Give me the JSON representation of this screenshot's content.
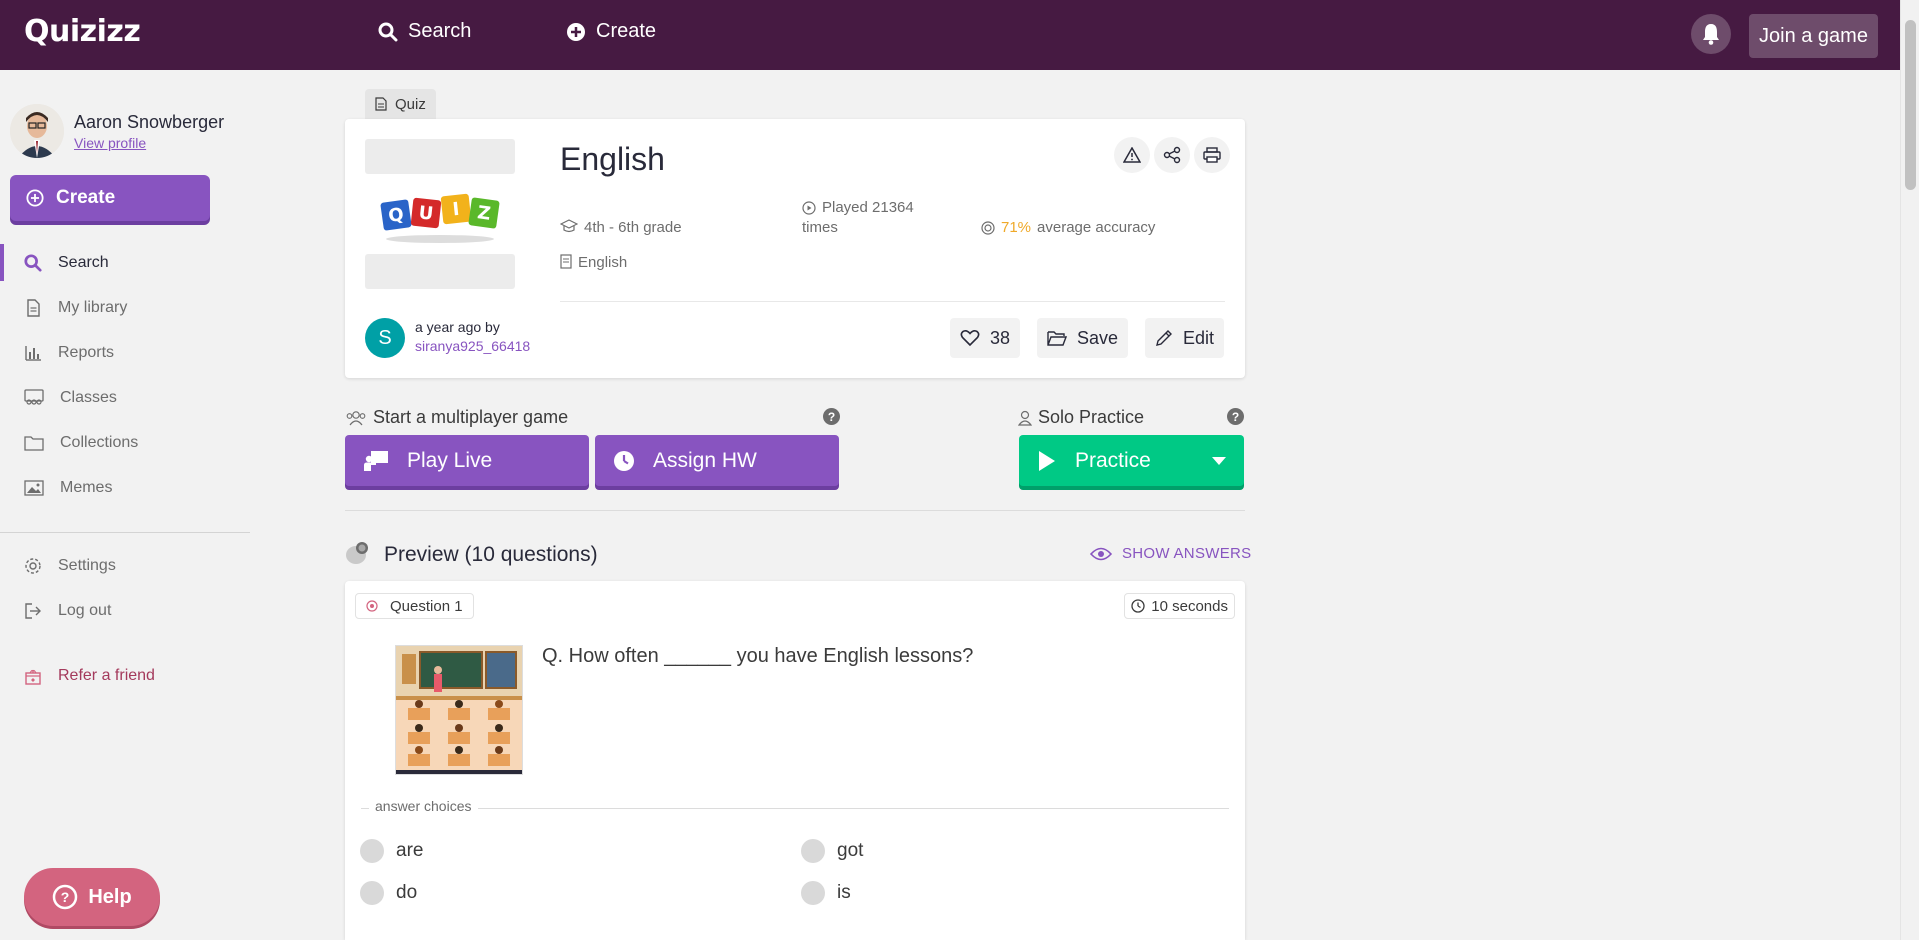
{
  "topbar": {
    "logo": "Quizizz",
    "search_label": "Search",
    "create_label": "Create",
    "join_label": "Join a game"
  },
  "sidebar": {
    "user_name": "Aaron Snowberger",
    "view_profile": "View profile",
    "create_label": "Create",
    "items": [
      {
        "label": "Search",
        "icon": "search-icon",
        "active": true
      },
      {
        "label": "My library",
        "icon": "document-icon"
      },
      {
        "label": "Reports",
        "icon": "bar-chart-icon"
      },
      {
        "label": "Classes",
        "icon": "people-icon"
      },
      {
        "label": "Collections",
        "icon": "folder-icon"
      },
      {
        "label": "Memes",
        "icon": "image-icon"
      }
    ],
    "settings": "Settings",
    "logout": "Log out",
    "refer": "Refer a friend",
    "help": "Help"
  },
  "quiz": {
    "tag": "Quiz",
    "title": "English",
    "grade": "4th - 6th grade",
    "subject": "English",
    "played_line1": "Played 21364",
    "played_line2": "times",
    "accuracy_value": "71%",
    "accuracy_label": "average accuracy",
    "author_initial": "S",
    "author_when": "a year ago by",
    "author_name": "siranya925_66418",
    "likes": "38",
    "save": "Save",
    "edit": "Edit"
  },
  "actions": {
    "multiplayer_label": "Start a multiplayer game",
    "play_live": "Play Live",
    "assign_hw": "Assign HW",
    "solo_label": "Solo Practice",
    "practice": "Practice",
    "help_glyph": "?"
  },
  "preview": {
    "title": "Preview (10 questions)",
    "show_answers": "SHOW ANSWERS"
  },
  "question": {
    "number": "Question 1",
    "time": "10 seconds",
    "text": "Q. How often ______ you have English lessons?",
    "answer_choices_label": "answer choices",
    "choices": [
      "are",
      "got",
      "do",
      "is"
    ]
  },
  "colors": {
    "topbar": "#461a42",
    "accent": "#8854c0",
    "practice": "#00c985",
    "accuracy": "#efa929",
    "help": "#d3647f"
  }
}
